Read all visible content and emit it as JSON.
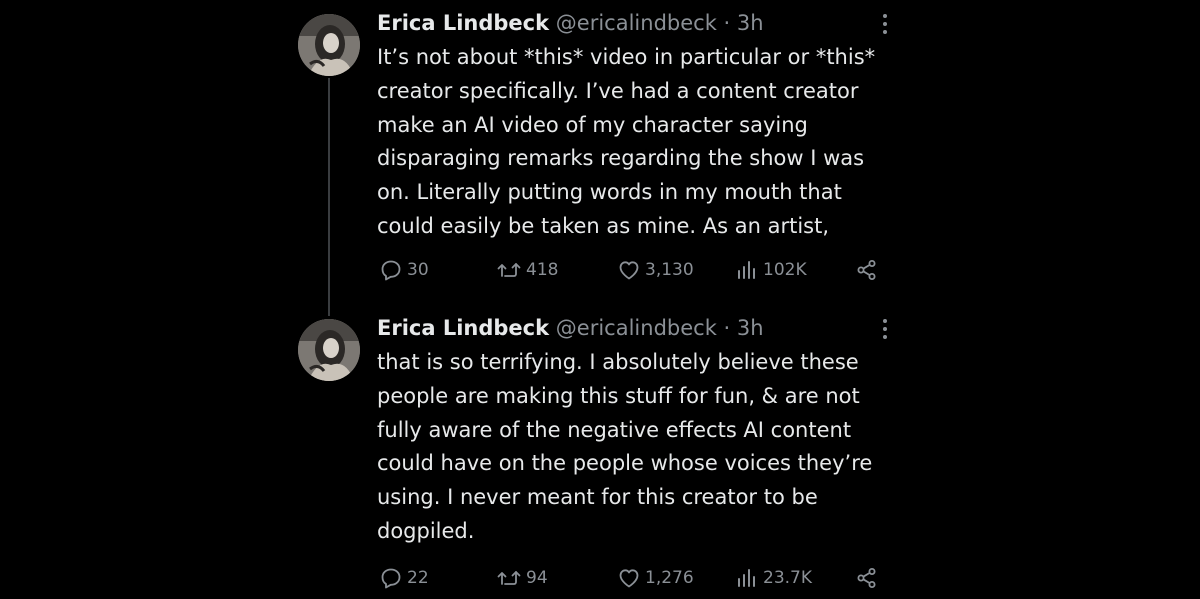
{
  "tweets": [
    {
      "author": {
        "name": "Erica Lindbeck",
        "handle": "@ericalindbeck",
        "separator": "·",
        "time": "3h"
      },
      "text": "It’s not about *this* video in particular or *this* creator specifically. I’ve had a content creator make an AI video of my character saying disparaging remarks regarding the show I was on. Literally putting words in my mouth that could easily be taken as mine. As an artist,",
      "stats": {
        "replies": "30",
        "reposts": "418",
        "likes": "3,130",
        "views": "102K"
      }
    },
    {
      "author": {
        "name": "Erica Lindbeck",
        "handle": "@ericalindbeck",
        "separator": "·",
        "time": "3h"
      },
      "text": "that is so terrifying. I absolutely believe these people are making this stuff for fun, & are not fully aware of the negative effects AI content could have on the people whose voices they’re using. I never meant for this creator to be dogpiled.",
      "stats": {
        "replies": "22",
        "reposts": "94",
        "likes": "1,276",
        "views": "23.7K"
      }
    }
  ],
  "icons": {
    "reply": "reply-icon",
    "repost": "repost-icon",
    "like": "heart-icon",
    "views": "views-icon",
    "share": "share-icon",
    "more": "more-vertical-icon"
  },
  "colors": {
    "background": "#000000",
    "text": "#e7e9ea",
    "secondary": "#8b9096",
    "thread_line": "#3a3d40"
  }
}
